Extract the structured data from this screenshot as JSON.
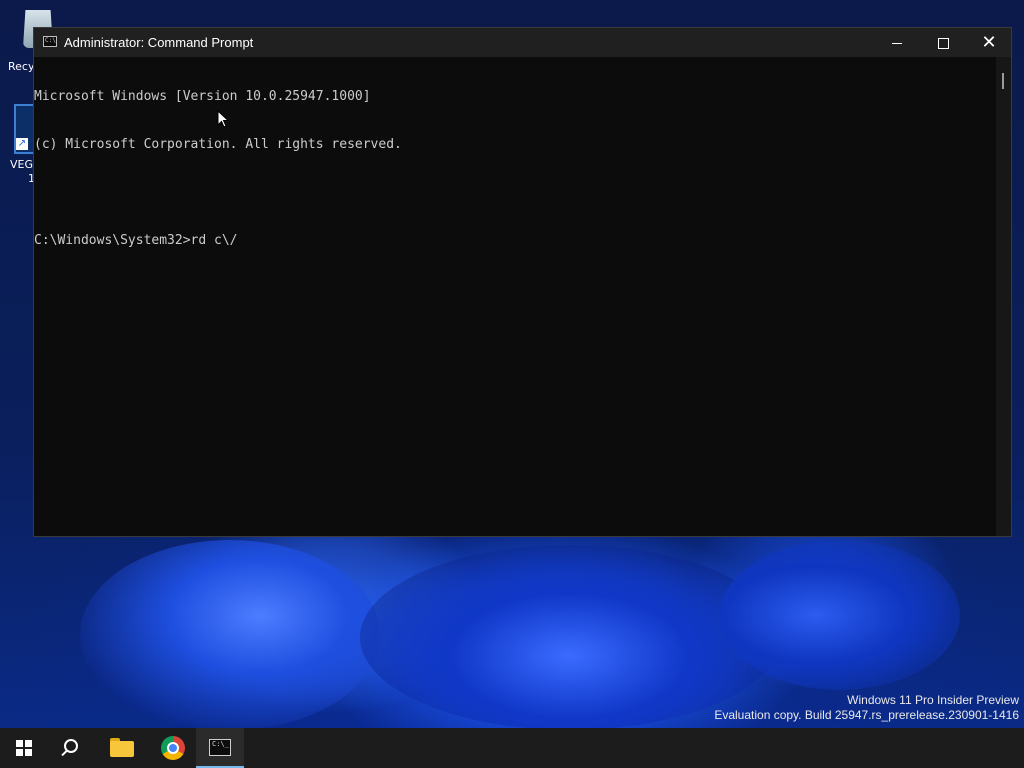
{
  "desktop": {
    "icons": [
      {
        "name": "recycle-bin",
        "label": "Recy"
      },
      {
        "name": "vega-shortcut",
        "label": "VEG",
        "label2": "1"
      }
    ]
  },
  "window": {
    "title": "Administrator: Command Prompt",
    "icon": "cmd-icon",
    "controls": {
      "minimize": "minimize-icon",
      "maximize": "maximize-icon",
      "close": "close-icon"
    }
  },
  "console": {
    "lines": [
      "Microsoft Windows [Version 10.0.25947.1000]",
      "(c) Microsoft Corporation. All rights reserved.",
      "",
      "C:\\Windows\\System32>rd c\\/"
    ]
  },
  "watermark": {
    "line1": "Windows 11 Pro Insider Preview",
    "line2": "Evaluation copy. Build 25947.rs_prerelease.230901-1416"
  },
  "taskbar": {
    "items": [
      "start-icon",
      "search-icon",
      "file-explorer-icon",
      "chrome-icon",
      "command-prompt-icon"
    ],
    "active": "command-prompt-icon"
  },
  "colors": {
    "console_bg": "#0c0c0c",
    "console_text": "#cccccc",
    "titlebar_bg": "#202020",
    "taskbar_bg": "#1c1c1c",
    "active_indicator": "#76b9ed"
  }
}
